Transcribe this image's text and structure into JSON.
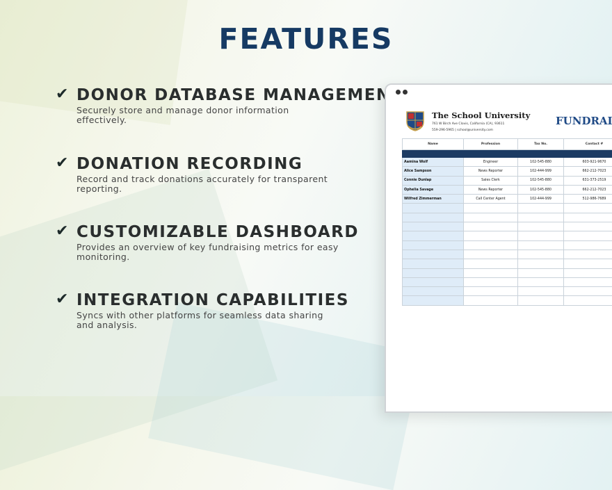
{
  "title": "FEATURES",
  "features": [
    {
      "title": "DONOR DATABASE MANAGEMENT",
      "desc": "Securely store and manage donor information effectively."
    },
    {
      "title": "DONATION RECORDING",
      "desc": "Record and track donations accurately for transparent reporting."
    },
    {
      "title": "CUSTOMIZABLE DASHBOARD",
      "desc": "Provides an overview of key fundraising metrics for easy monitoring."
    },
    {
      "title": "INTEGRATION CAPABILITIES",
      "desc": "Syncs with other platforms for seamless data sharing and analysis."
    }
  ],
  "check_icon": "check-icon",
  "preview": {
    "university": "The School University",
    "address": "761 W Birch Ave Clovis, California (CA), 93611",
    "contact": "559-296-5965 | school@university.com",
    "sheet_title": "FUNDRAIS",
    "columns": [
      "Name",
      "Profession",
      "Tax No.",
      "Contact #"
    ],
    "rows": [
      [
        "Aamina Wolf",
        "Engineer",
        "102-545-880",
        "603-921-9670"
      ],
      [
        "Alice Sampson",
        "News Reporter",
        "102-444-999",
        "662-212-7023"
      ],
      [
        "Connie Dunlap",
        "Sales Clerk",
        "102-545-880",
        "631-373-2519"
      ],
      [
        "Ophelia Savage",
        "News Reporter",
        "102-545-880",
        "662-212-7023"
      ],
      [
        "Wilfred Zimmerman",
        "Call Center Agent",
        "102-444-999",
        "512-986-7689"
      ],
      [
        "",
        "",
        "",
        ""
      ],
      [
        "",
        "",
        "",
        ""
      ],
      [
        "",
        "",
        "",
        ""
      ],
      [
        "",
        "",
        "",
        ""
      ],
      [
        "",
        "",
        "",
        ""
      ],
      [
        "",
        "",
        "",
        ""
      ],
      [
        "",
        "",
        "",
        ""
      ],
      [
        "",
        "",
        "",
        ""
      ],
      [
        "",
        "",
        "",
        ""
      ],
      [
        "",
        "",
        "",
        ""
      ],
      [
        "",
        "",
        "",
        ""
      ]
    ]
  },
  "colors": {
    "title": "#163a63",
    "band": "#1c3b63",
    "accent": "#1f4a86",
    "name_col": "#dfecf8"
  }
}
